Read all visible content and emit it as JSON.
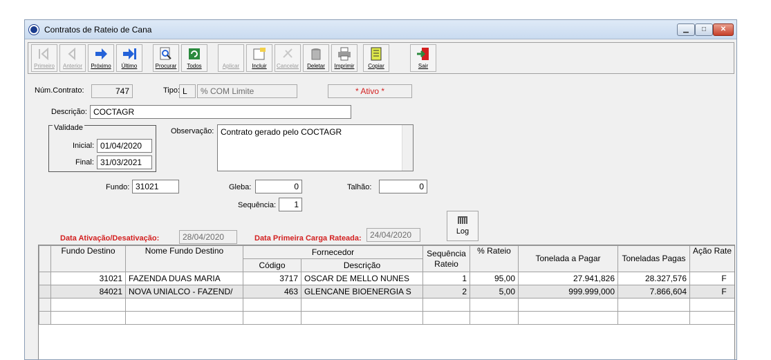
{
  "window": {
    "title": "Contratos de Rateio de Cana"
  },
  "toolbar": {
    "buttons": [
      {
        "label": "Primeiro",
        "enabled": false
      },
      {
        "label": "Anterior",
        "enabled": false
      },
      {
        "label": "Próximo",
        "enabled": true
      },
      {
        "label": "Último",
        "enabled": true
      },
      {
        "label": "Procurar",
        "enabled": true
      },
      {
        "label": "Todos",
        "enabled": true
      },
      {
        "label": "Aplicar",
        "enabled": false
      },
      {
        "label": "Incluir",
        "enabled": true
      },
      {
        "label": "Cancelar",
        "enabled": false
      },
      {
        "label": "Deletar",
        "enabled": true
      },
      {
        "label": "Imprimir",
        "enabled": true
      },
      {
        "label": "Copiar",
        "enabled": true
      },
      {
        "label": "Sair",
        "enabled": true
      }
    ]
  },
  "form": {
    "num_contrato_label": "Núm.Contrato:",
    "num_contrato": "747",
    "tipo_label": "Tipo:",
    "tipo_code": "L",
    "tipo_desc": "% COM Limite",
    "status": "* Ativo *",
    "descricao_label": "Descrição:",
    "descricao": "COCTAGR",
    "validade_label": "Validade",
    "inicial_label": "Inicial:",
    "inicial": "01/04/2020",
    "final_label": "Final:",
    "final": "31/03/2021",
    "observacao_label": "Observação:",
    "observacao": "Contrato gerado pelo COCTAGR",
    "fundo_label": "Fundo:",
    "fundo": "31021",
    "gleba_label": "Gleba:",
    "gleba": "0",
    "talhao_label": "Talhão:",
    "talhao": "0",
    "sequencia_label": "Sequência:",
    "sequencia": "1",
    "data_ativacao_label": "Data Ativação/Desativação:",
    "data_ativacao": "28/04/2020",
    "data_primeira_carga_label": "Data Primeira Carga Rateada:",
    "data_primeira_carga": "24/04/2020",
    "log_label": "Log"
  },
  "grid": {
    "headers": {
      "fundo_destino": "Fundo Destino",
      "nome_fundo_destino": "Nome Fundo Destino",
      "fornecedor": "Fornecedor",
      "codigo": "Código",
      "descricao": "Descrição",
      "sequencia_rateio": "Sequência Rateio",
      "pct_rateio": "% Rateio",
      "tonelada_a_pagar": "Tonelada a Pagar",
      "toneladas_pagas": "Toneladas Pagas",
      "acao_rate": "Ação Rate"
    },
    "rows": [
      {
        "fundo": "31021",
        "nome": "FAZENDA DUAS MARIA",
        "codigo": "3717",
        "descricao": "OSCAR DE MELLO NUNES",
        "sequencia": "1",
        "rateio": "95,00",
        "a_pagar": "27.941,826",
        "pagas": "28.327,576",
        "acao": "F"
      },
      {
        "fundo": "84021",
        "nome": "NOVA UNIALCO - FAZEND/",
        "codigo": "463",
        "descricao": "GLENCANE BIOENERGIA S",
        "sequencia": "2",
        "rateio": "5,00",
        "a_pagar": "999.999,000",
        "pagas": "7.866,604",
        "acao": "F"
      }
    ]
  }
}
